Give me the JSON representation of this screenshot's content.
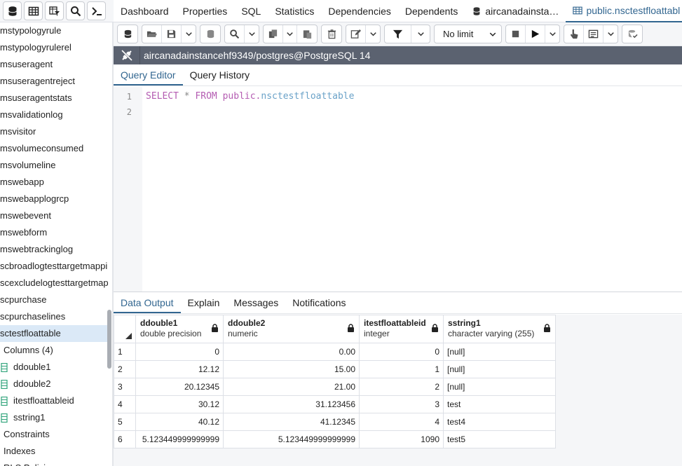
{
  "left_toolbar": {
    "icons": [
      "database-icon",
      "table-grid-icon",
      "filter-table-icon",
      "search-icon",
      "terminal-icon"
    ]
  },
  "tree": {
    "items": [
      {
        "label": "mstypologyrule",
        "selected": false
      },
      {
        "label": "mstypologyrulerel",
        "selected": false
      },
      {
        "label": "msuseragent",
        "selected": false
      },
      {
        "label": "msuseragentreject",
        "selected": false
      },
      {
        "label": "msuseragentstats",
        "selected": false
      },
      {
        "label": "msvalidationlog",
        "selected": false
      },
      {
        "label": "msvisitor",
        "selected": false
      },
      {
        "label": "msvolumeconsumed",
        "selected": false
      },
      {
        "label": "msvolumeline",
        "selected": false
      },
      {
        "label": "mswebapp",
        "selected": false
      },
      {
        "label": "mswebapplogrcp",
        "selected": false
      },
      {
        "label": "mswebevent",
        "selected": false
      },
      {
        "label": "mswebform",
        "selected": false
      },
      {
        "label": "mswebtrackinglog",
        "selected": false
      },
      {
        "label": "scbroadlogtesttargetmappi",
        "selected": false
      },
      {
        "label": "scexcludelogtesttargetmap",
        "selected": false
      },
      {
        "label": "scpurchase",
        "selected": false
      },
      {
        "label": "scpurchaselines",
        "selected": false
      },
      {
        "label": "sctestfloattable",
        "selected": true
      }
    ],
    "columns_label": "Columns (4)",
    "columns": [
      "ddouble1",
      "ddouble2",
      "itestfloattableid",
      "sstring1"
    ],
    "after": [
      "Constraints",
      "Indexes",
      "RLS Policies"
    ]
  },
  "tabs": [
    {
      "label": "Dashboard",
      "icon": null,
      "active": false
    },
    {
      "label": "Properties",
      "icon": null,
      "active": false
    },
    {
      "label": "SQL",
      "icon": null,
      "active": false
    },
    {
      "label": "Statistics",
      "icon": null,
      "active": false
    },
    {
      "label": "Dependencies",
      "icon": null,
      "active": false
    },
    {
      "label": "Dependents",
      "icon": null,
      "active": false
    },
    {
      "label": "aircanadainsta…",
      "icon": "database-icon",
      "active": false
    },
    {
      "label": "public.nsctestfloattabl",
      "icon": "table-icon",
      "active": true
    }
  ],
  "query_toolbar": {
    "limit_label": "No limit"
  },
  "connection": {
    "label": "aircanadainstancehf9349/postgres@PostgreSQL 14"
  },
  "editor_tabs": [
    {
      "label": "Query Editor",
      "active": true
    },
    {
      "label": "Query History",
      "active": false
    }
  ],
  "editor": {
    "line_numbers": [
      "1",
      "2"
    ],
    "sql": {
      "select": "SELECT",
      "star": "*",
      "from": "FROM",
      "schema": "public.",
      "table": "nsctestfloattable"
    }
  },
  "output_tabs": [
    {
      "label": "Data Output",
      "active": true
    },
    {
      "label": "Explain",
      "active": false
    },
    {
      "label": "Messages",
      "active": false
    },
    {
      "label": "Notifications",
      "active": false
    }
  ],
  "grid": {
    "columns": [
      {
        "name": "ddouble1",
        "type": "double precision"
      },
      {
        "name": "ddouble2",
        "type": "numeric"
      },
      {
        "name": "itestfloattableid",
        "type": "integer"
      },
      {
        "name": "sstring1",
        "type": "character varying (255)"
      }
    ],
    "rows": [
      [
        "1",
        "0",
        "0.00",
        "0",
        "[null]"
      ],
      [
        "2",
        "12.12",
        "15.00",
        "1",
        "[null]"
      ],
      [
        "3",
        "20.12345",
        "21.00",
        "2",
        "[null]"
      ],
      [
        "4",
        "30.12",
        "31.123456",
        "3",
        "test"
      ],
      [
        "5",
        "40.12",
        "41.12345",
        "4",
        "test4"
      ],
      [
        "6",
        "5.123449999999999",
        "5.123449999999999",
        "1090",
        "test5"
      ]
    ]
  }
}
